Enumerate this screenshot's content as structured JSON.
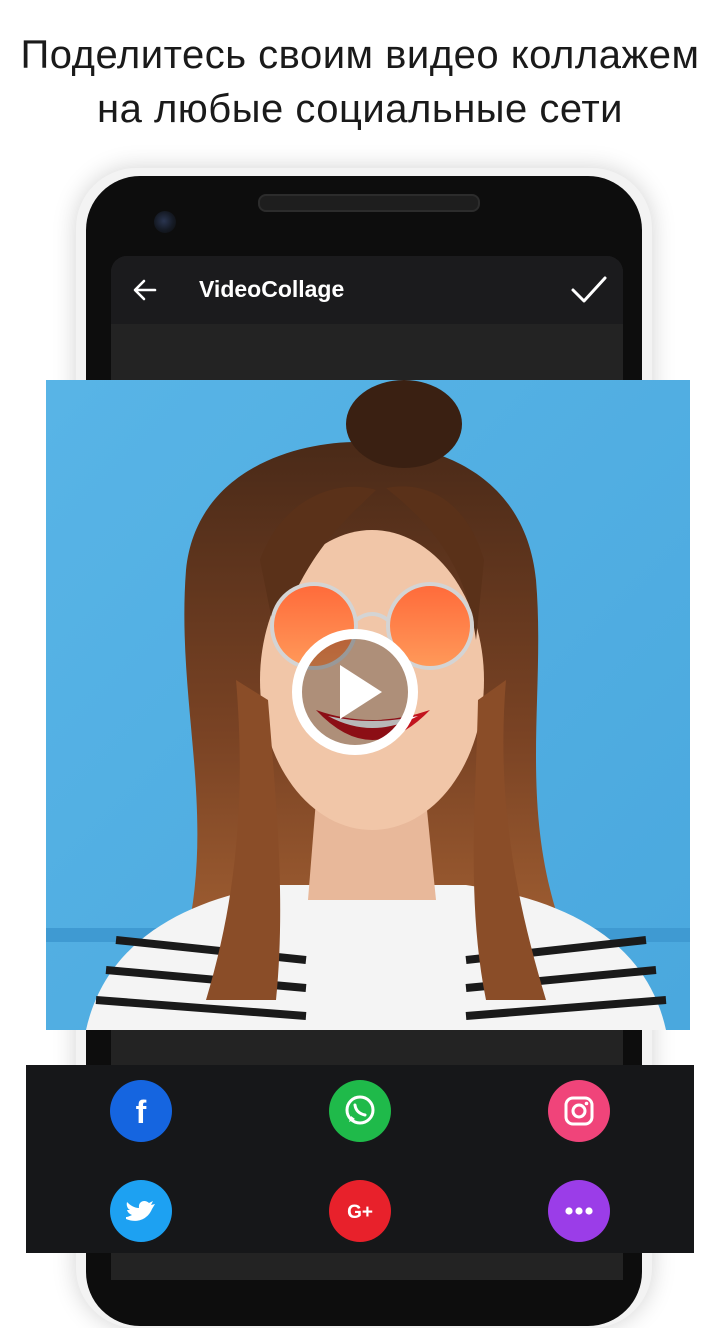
{
  "headline": {
    "line1": "Поделитесь своим видео коллажем",
    "line2": "на любые социальные сети"
  },
  "app": {
    "title": "VideoCollage",
    "back_icon": "arrow-left-icon",
    "confirm_icon": "checkmark-icon"
  },
  "preview": {
    "play_icon": "play-icon"
  },
  "share": {
    "buttons": [
      {
        "name": "facebook",
        "glyph": "f",
        "icon": "facebook-icon",
        "color": "#1565e0"
      },
      {
        "name": "whatsapp",
        "icon": "whatsapp-icon",
        "color": "#1fba4a"
      },
      {
        "name": "instagram",
        "icon": "instagram-icon",
        "color": "#f0447a"
      },
      {
        "name": "twitter",
        "icon": "twitter-icon",
        "color": "#1da1f2"
      },
      {
        "name": "google-plus",
        "glyph": "G+",
        "icon": "google-plus-icon",
        "color": "#e8212b"
      },
      {
        "name": "more",
        "icon": "more-dots-icon",
        "color": "#9b3de8"
      }
    ]
  },
  "colors": {
    "background": "#ffffff",
    "appbar": "#1b1b1d",
    "screen": "#232323",
    "share_panel": "#161719",
    "photo_bg": "#5fb9e8"
  }
}
